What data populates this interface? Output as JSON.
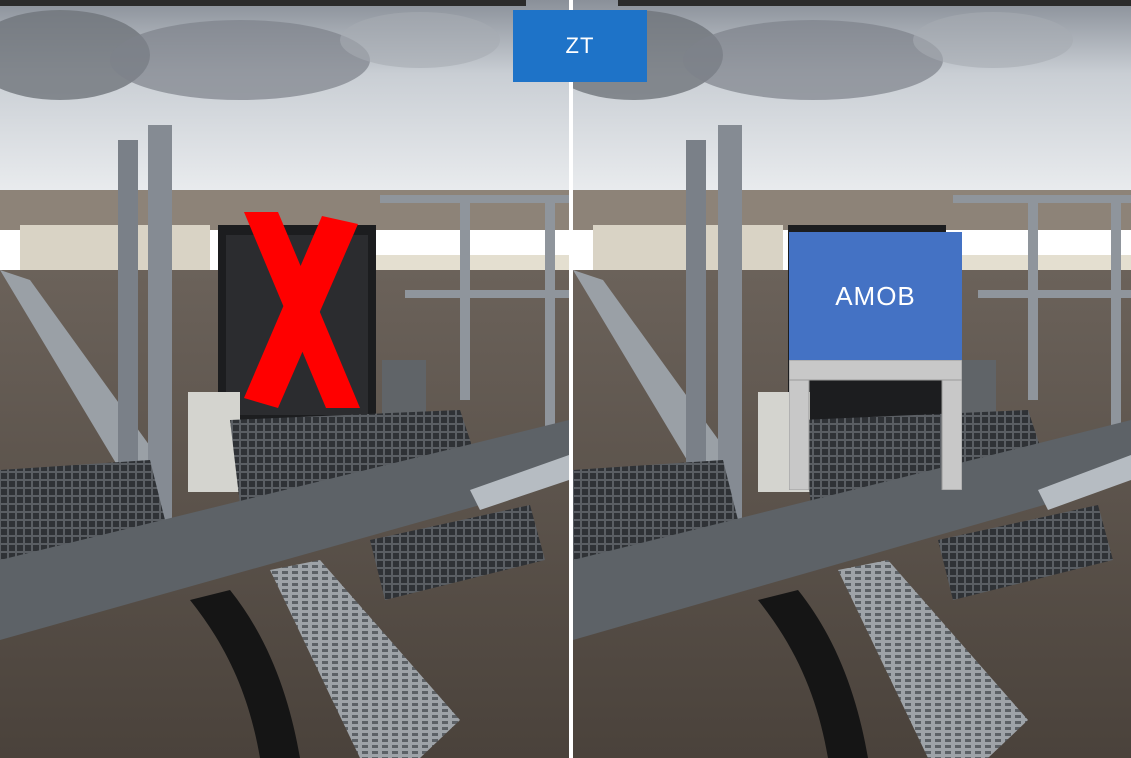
{
  "labels": {
    "zt": "ZT",
    "amob": "AMOB"
  },
  "colors": {
    "zt_fill": "#1e73c8",
    "amob_fill": "#4472c4",
    "cross": "#ff0000",
    "stand": "#c8c8c8"
  },
  "icons": {
    "cross": "red-x-mark",
    "stand": "amob-stand-frame"
  }
}
